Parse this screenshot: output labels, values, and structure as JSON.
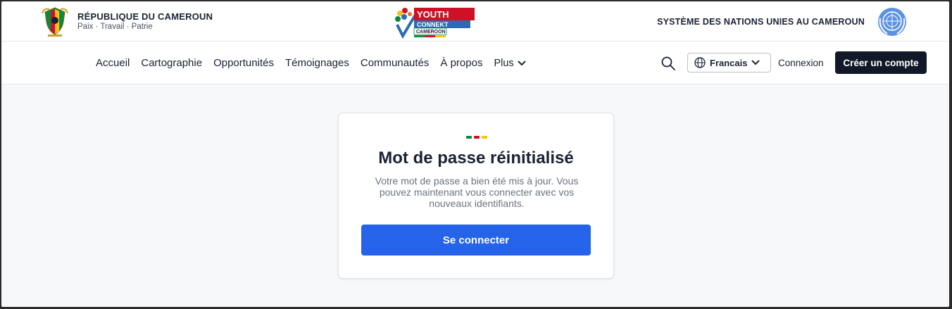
{
  "header": {
    "republic_title": "RÉPUBLIQUE DU CAMEROUN",
    "republic_motto": "Paix · Travail · Patrie",
    "logo_text_line1": "YOUTH",
    "logo_text_line2": "CONNEKT",
    "logo_text_line3": "CAMEROON",
    "un_title": "SYSTÈME DES NATIONS UNIES AU CAMEROUN"
  },
  "nav": {
    "items": [
      "Accueil",
      "Cartographie",
      "Opportunités",
      "Témoignages",
      "Communautés",
      "À propos"
    ],
    "more_label": "Plus",
    "language_label": "Francais",
    "login_label": "Connexion",
    "signup_label": "Créer un compte"
  },
  "card": {
    "title": "Mot de passe réinitialisé",
    "description": "Votre mot de passe a bien été mis à jour. Vous pouvez maintenant vous connecter avec vos nouveaux identifiants.",
    "button_label": "Se connecter"
  },
  "colors": {
    "flag_green": "#0b8a3e",
    "flag_red": "#ce1126",
    "flag_yellow": "#f6c21b",
    "primary": "#2563eb",
    "dark": "#111827"
  },
  "icons": [
    "coat-of-arms-icon",
    "youth-connekt-logo",
    "un-emblem-icon",
    "search-icon",
    "globe-icon",
    "chevron-down-icon"
  ]
}
